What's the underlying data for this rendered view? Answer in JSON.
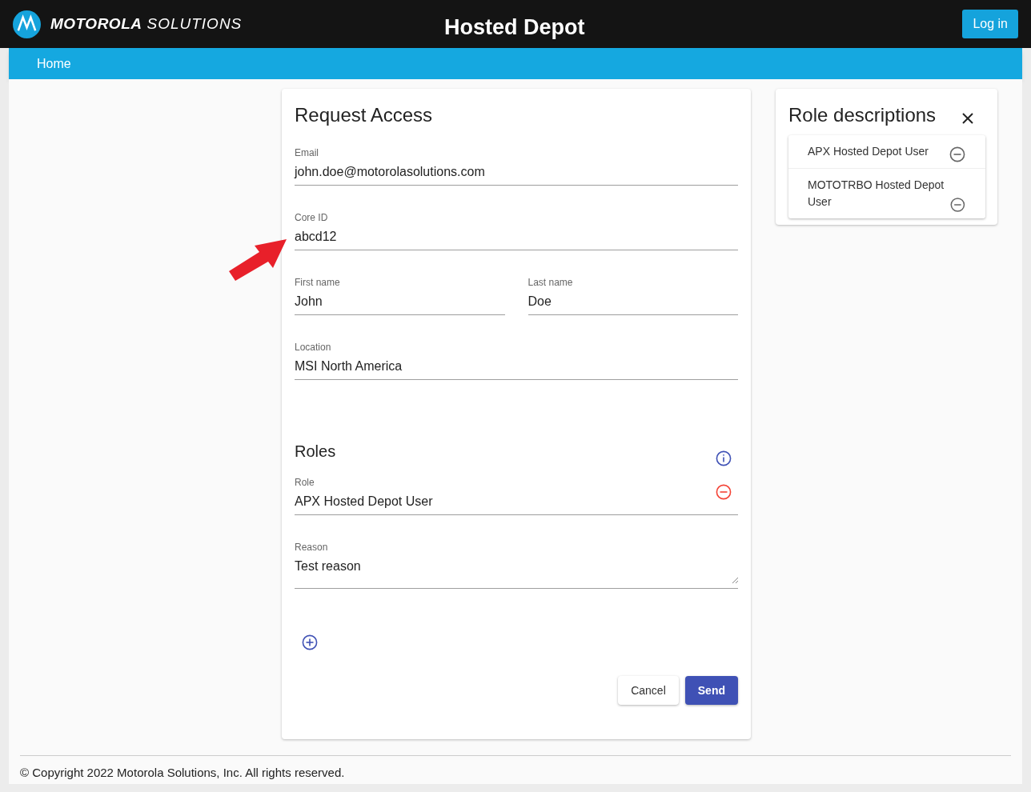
{
  "header": {
    "brand_bold": "MOTOROLA",
    "brand_light": "SOLUTIONS",
    "title": "Hosted Depot",
    "login_button": "Log in"
  },
  "nav": {
    "items": [
      {
        "label": "Home",
        "selected": true
      }
    ]
  },
  "form": {
    "title": "Request Access",
    "rows": [
      [
        {
          "label": "Email",
          "value": "john.doe@motorolasolutions.com"
        }
      ],
      [
        {
          "label": "Core ID",
          "value": "abcd12"
        }
      ],
      [
        {
          "label": "First name",
          "value": "John"
        },
        {
          "label": "Last name",
          "value": "Doe"
        }
      ],
      [
        {
          "label": "Location",
          "value": "MSI North America"
        }
      ]
    ],
    "roles_title": "Roles",
    "roles": [
      {
        "role_label": "Role",
        "role_value": "APX Hosted Depot User",
        "reason_label": "Reason",
        "reason_value": "Test reason"
      }
    ],
    "buttons": [
      {
        "label": "Cancel",
        "kind": "secondary"
      },
      {
        "label": "Send",
        "kind": "primary"
      }
    ]
  },
  "role_descriptions": {
    "title": "Role descriptions",
    "items": [
      {
        "label": "APX Hosted Depot User"
      },
      {
        "label": "MOTOTRBO Hosted Depot User"
      }
    ]
  },
  "footer": {
    "text": "© Copyright 2022 Motorola Solutions, Inc. All rights reserved."
  }
}
